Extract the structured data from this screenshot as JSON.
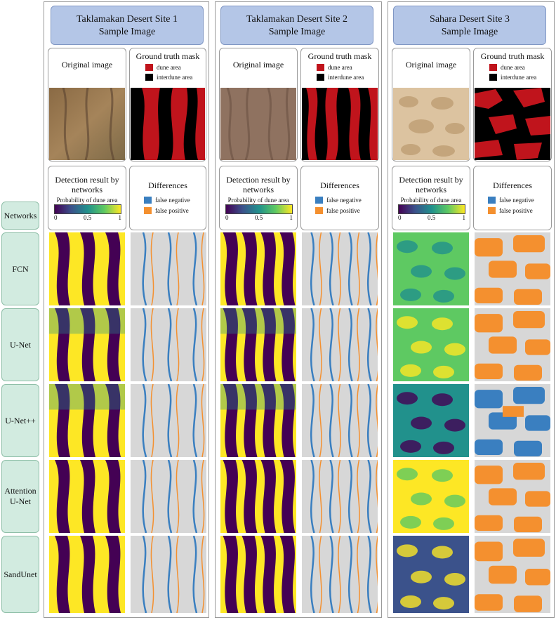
{
  "columns": [
    {
      "title_line1": "Taklamakan Desert Site 1",
      "title_line2": "Sample Image",
      "original_label": "Original image",
      "ground_truth_label": "Ground truth mask",
      "gt_legend": [
        "dune area",
        "interdune area"
      ],
      "detection_label": "Detection result by networks",
      "colorbar_label": "Probability of dune area",
      "ticks": [
        "0",
        "0.5",
        "1"
      ],
      "differences_label": "Differences",
      "diff_legend": [
        "false negative",
        "false positive"
      ]
    },
    {
      "title_line1": "Taklamakan Desert Site 2",
      "title_line2": "Sample Image",
      "original_label": "Original image",
      "ground_truth_label": "Ground truth mask",
      "gt_legend": [
        "dune area",
        "interdune area"
      ],
      "detection_label": "Detection result by networks",
      "colorbar_label": "Probability of dune area",
      "ticks": [
        "0",
        "0.5",
        "1"
      ],
      "differences_label": "Differences",
      "diff_legend": [
        "false negative",
        "false positive"
      ]
    },
    {
      "title_line1": "Sahara Desert Site 3",
      "title_line2": "Sample Image",
      "original_label": "Original image",
      "ground_truth_label": "Ground truth mask",
      "gt_legend": [
        "dune area",
        "interdune area"
      ],
      "detection_label": "Detection result by networks",
      "colorbar_label": "Probability of dune area",
      "ticks": [
        "0",
        "0.5",
        "1"
      ],
      "differences_label": "Differences",
      "diff_legend": [
        "false negative",
        "false positive"
      ]
    }
  ],
  "networks_header": "Networks",
  "networks": [
    "FCN",
    "U-Net",
    "U-Net++",
    "Attention U-Net",
    "SandUnet"
  ],
  "colors": {
    "title_bg": "#b4c6e7",
    "network_bg": "#d2ebe0",
    "dune": "#c0141c",
    "interdune": "#000000",
    "false_negative": "#3a7fc0",
    "false_positive": "#f4902f",
    "diff_bg": "#d7d7d7",
    "viridis": [
      "#440154",
      "#3b528b",
      "#21918c",
      "#5ec962",
      "#fde725"
    ]
  }
}
